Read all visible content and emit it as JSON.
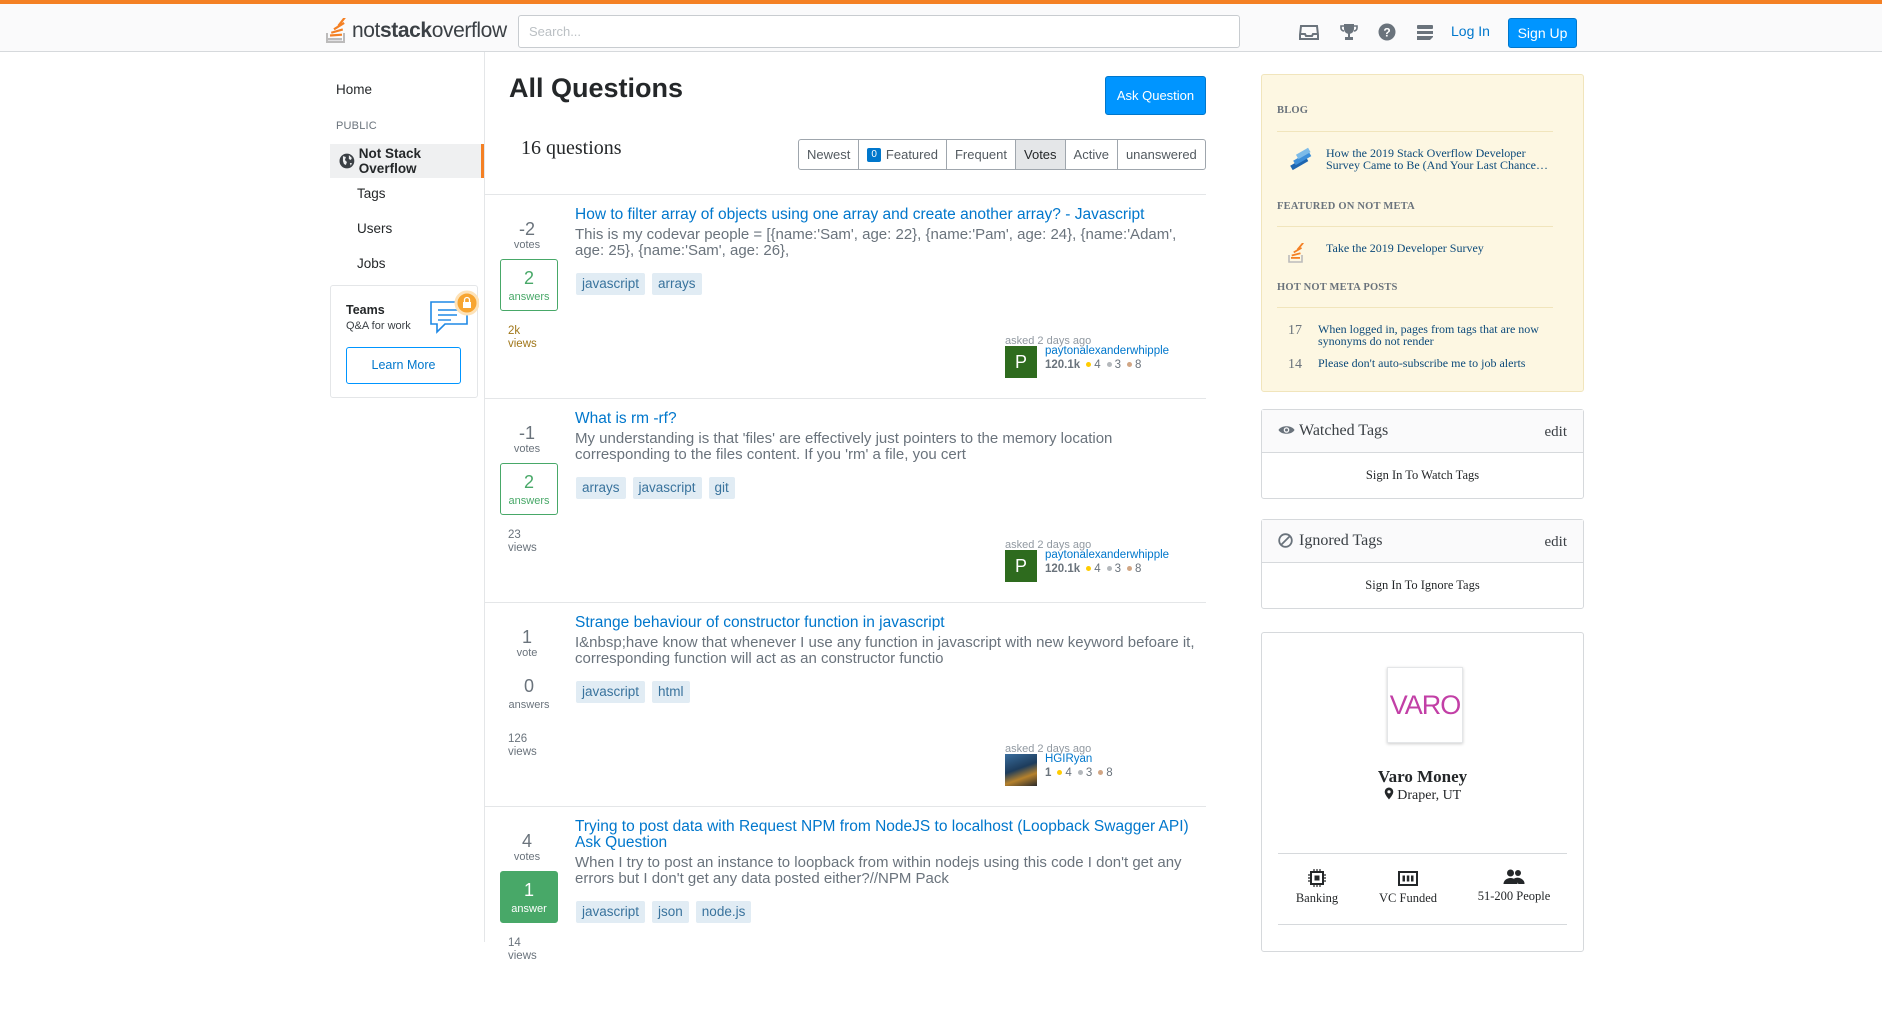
{
  "header": {
    "logo_plain": "not",
    "logo_bold": "stack",
    "logo_rest": "overflow",
    "search_placeholder": "Search...",
    "icons": [
      "inbox-icon",
      "trophy-icon",
      "help-icon",
      "site-switcher-icon"
    ],
    "login": "Log In",
    "signup": "Sign Up"
  },
  "nav": {
    "home": "Home",
    "public": "PUBLIC",
    "active": "Not Stack Overflow",
    "items": [
      "Tags",
      "Users",
      "Jobs"
    ],
    "teams": {
      "title": "Teams",
      "subtitle": "Q&A for work",
      "button": "Learn More"
    }
  },
  "main": {
    "title": "All Questions",
    "ask": "Ask Question",
    "count": "16 questions",
    "filters": [
      {
        "label": "Newest"
      },
      {
        "label": "Featured",
        "badge": "0"
      },
      {
        "label": "Frequent"
      },
      {
        "label": "Votes",
        "active": true
      },
      {
        "label": "Active"
      },
      {
        "label": "unanswered"
      }
    ]
  },
  "questions": [
    {
      "votes": "-2",
      "votes_label": "votes",
      "answers": "2",
      "answers_label": "answers",
      "views": "2k",
      "views_label": "views",
      "title": "How to filter array of objects using one array and create another array? - Javascript",
      "excerpt": "This is my codevar people = [{name:'Sam', age: 22}, {name:'Pam', age: 24}, {name:'Adam', age: 25}, {name:'Sam', age: 26},",
      "tags": [
        "javascript",
        "arrays"
      ],
      "asked": "asked 2 days ago",
      "user": "paytonalexanderwhipple",
      "avatar": "P",
      "rep": "120.1k",
      "gold": "4",
      "silver": "3",
      "bronze": "8"
    },
    {
      "votes": "-1",
      "votes_label": "votes",
      "answers": "2",
      "answers_label": "answers",
      "views": "23",
      "views_label": "views",
      "title": "What is rm -rf?",
      "excerpt": "My understanding is that 'files' are effectively just pointers to the memory location corresponding to the files content. If you 'rm' a file, you cert",
      "tags": [
        "arrays",
        "javascript",
        "git"
      ],
      "asked": "asked 2 days ago",
      "user": "paytonalexanderwhipple",
      "avatar": "P",
      "rep": "120.1k",
      "gold": "4",
      "silver": "3",
      "bronze": "8"
    },
    {
      "votes": "1",
      "votes_label": "vote",
      "answers": "0",
      "answers_label": "answers",
      "views": "126",
      "views_label": "views",
      "title": "Strange behaviour of constructor function in javascript",
      "excerpt": "I&nbsp;have know that whenever I use any function in javascript with new keyword befoare it, corresponding function will act as an constructor functio",
      "tags": [
        "javascript",
        "html"
      ],
      "asked": "asked 2 days ago",
      "user": "HGIRyan",
      "avatar": "",
      "rep": "1",
      "gold": "4",
      "silver": "3",
      "bronze": "8"
    },
    {
      "votes": "4",
      "votes_label": "votes",
      "answers": "1",
      "answers_label": "answer",
      "views": "14",
      "views_label": "views",
      "title": "Trying to post data with Request NPM from NodeJS to localhost (Loopback Swagger API) Ask Question",
      "excerpt": "When I try to post an instance to loopback from within nodejs using this code I don't get any errors but I don't get any data posted either?//NPM Pack",
      "tags": [
        "javascript",
        "json",
        "node.js"
      ]
    }
  ],
  "sidebar": {
    "blog_heading": "BLOG",
    "blog_link": "How the 2019 Stack Overflow Developer Survey Came to Be (And Your Last Chance…",
    "featured_heading": "FEATURED ON NOT META",
    "featured_link": "Take the 2019 Developer Survey",
    "hot_heading": "HOT NOT META POSTS",
    "hot": [
      {
        "num": "17",
        "text": "When logged in, pages from tags that are now synonyms do not render"
      },
      {
        "num": "14",
        "text": "Please don't auto-subscribe me to job alerts"
      }
    ],
    "watched": {
      "title": "Watched Tags",
      "edit": "edit",
      "body": "Sign In To Watch Tags"
    },
    "ignored": {
      "title": "Ignored Tags",
      "edit": "edit",
      "body": "Sign In To Ignore Tags"
    },
    "company": {
      "logo": "VARO",
      "name": "Varo Money",
      "location": "Draper, UT",
      "features": [
        {
          "icon": "chip-icon",
          "label": "Banking"
        },
        {
          "icon": "funding-icon",
          "label": "VC Funded"
        },
        {
          "icon": "people-icon",
          "label": "51-200 People"
        }
      ]
    }
  },
  "colors": {
    "accent": "#f48024",
    "primary": "#0095ff",
    "link": "#0077cc",
    "answered": "#48a868"
  }
}
